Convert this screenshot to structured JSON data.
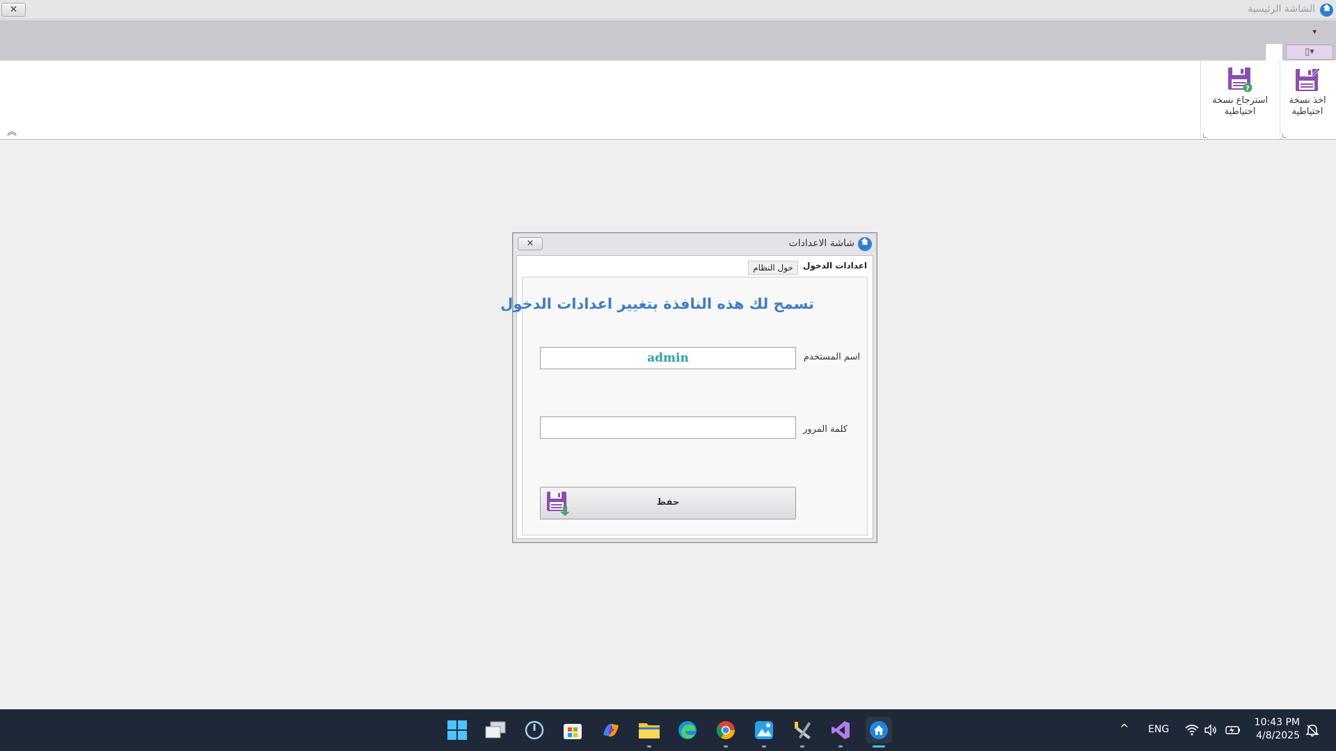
{
  "window": {
    "title": "الشاشة الرئيسية",
    "close_glyph": "✕"
  },
  "ribbon": {
    "qat_arrow": "▾",
    "view_menu_glyph": "▯▾",
    "collapse_glyph": "︽",
    "buttons": [
      {
        "label_line1": "اخذ نسخة",
        "label_line2": "احتياطية",
        "icon": "floppy-edit-icon"
      },
      {
        "label_line1": "استرجاع نسخة",
        "label_line2": "احتياطية",
        "icon": "floppy-help-icon"
      }
    ],
    "accent_color": "#8a4fb0"
  },
  "dialog": {
    "title": "شاشة الاعدادات",
    "close_glyph": "✕",
    "tabs": [
      {
        "label": "اعدادات الدخول",
        "active": true
      },
      {
        "label": "حول النظام",
        "active": false
      }
    ],
    "headline": "تسمح لك هذه النافذة بتغيير اعدادات الدخول",
    "username_label": "اسم المستخدم",
    "username_value": "admin",
    "password_label": "كلمة المرور",
    "password_value": "",
    "save_label": "حفظ"
  },
  "taskbar": {
    "apps": [
      "windows-start-icon",
      "task-view-icon",
      "power-app-icon",
      "store-icon",
      "copilot-icon",
      "file-explorer-icon",
      "edge-icon",
      "chrome-icon",
      "photos-icon",
      "tools-icon",
      "visual-studio-icon",
      "home-app-icon"
    ],
    "language": "ENG",
    "time": "10:43 PM",
    "date": "4/8/2025",
    "tray_chevron": "^"
  }
}
